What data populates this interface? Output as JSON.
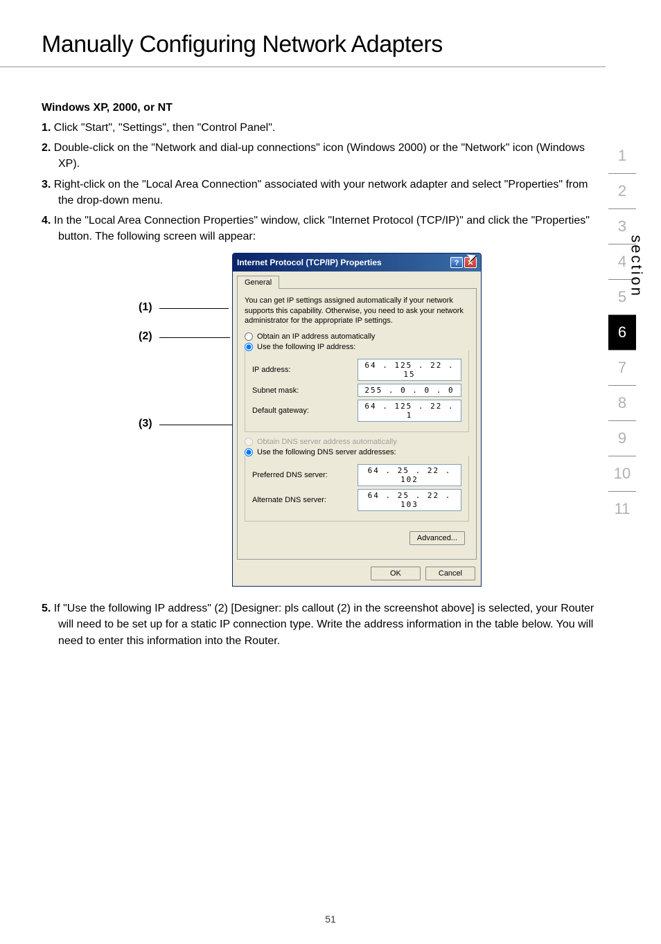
{
  "page": {
    "title": "Manually Configuring Network Adapters",
    "subheading": "Windows XP, 2000, or NT",
    "steps": {
      "s1_num": "1.",
      "s1": " Click \"Start\", \"Settings\", then \"Control Panel\".",
      "s2_num": "2.",
      "s2": " Double-click on the \"Network and dial-up connections\" icon (Windows 2000) or the \"Network\" icon (Windows XP).",
      "s3_num": "3.",
      "s3": " Right-click on the \"Local Area Connection\" associated with your network adapter and select \"Properties\" from the drop-down menu.",
      "s4_num": "4.",
      "s4": " In the \"Local Area Connection Properties\" window, click \"Internet Protocol (TCP/IP)\" and click the \"Properties\" button. The following screen will appear:",
      "s5_num": "5.",
      "s5": " If \"Use the following IP address\" (2) [Designer: pls callout (2) in the screenshot above] is selected, your Router will need to be set up for a static IP connection type. Write the address information in the table below. You will need to enter this information into the Router."
    },
    "callouts": {
      "c1": "(1)",
      "c2": "(2)",
      "c3": "(3)"
    },
    "section_label": "section",
    "page_number": "51"
  },
  "dialog": {
    "title": "Internet Protocol (TCP/IP) Properties",
    "help": "?",
    "close": "✕",
    "tab": "General",
    "description": "You can get IP settings assigned automatically if your network supports this capability. Otherwise, you need to ask your network administrator for the appropriate IP settings.",
    "radio_obtain_ip": "Obtain an IP address automatically",
    "radio_use_ip": "Use the following IP address:",
    "lbl_ip": "IP address:",
    "val_ip": "64 . 125 . 22 . 15",
    "lbl_subnet": "Subnet mask:",
    "val_subnet": "255 .  0  .  0  .  0",
    "lbl_gateway": "Default gateway:",
    "val_gateway": "64 . 125 . 22 .  1",
    "radio_obtain_dns": "Obtain DNS server address automatically",
    "radio_use_dns": "Use the following DNS server addresses:",
    "lbl_pref_dns": "Preferred DNS server:",
    "val_pref_dns": "64 . 25 . 22 . 102",
    "lbl_alt_dns": "Alternate DNS server:",
    "val_alt_dns": "64 . 25 . 22 . 103",
    "btn_advanced": "Advanced...",
    "btn_ok": "OK",
    "btn_cancel": "Cancel"
  },
  "sidenav": {
    "items": [
      "1",
      "2",
      "3",
      "4",
      "5",
      "6",
      "7",
      "8",
      "9",
      "10",
      "11"
    ],
    "active_index": 5
  }
}
